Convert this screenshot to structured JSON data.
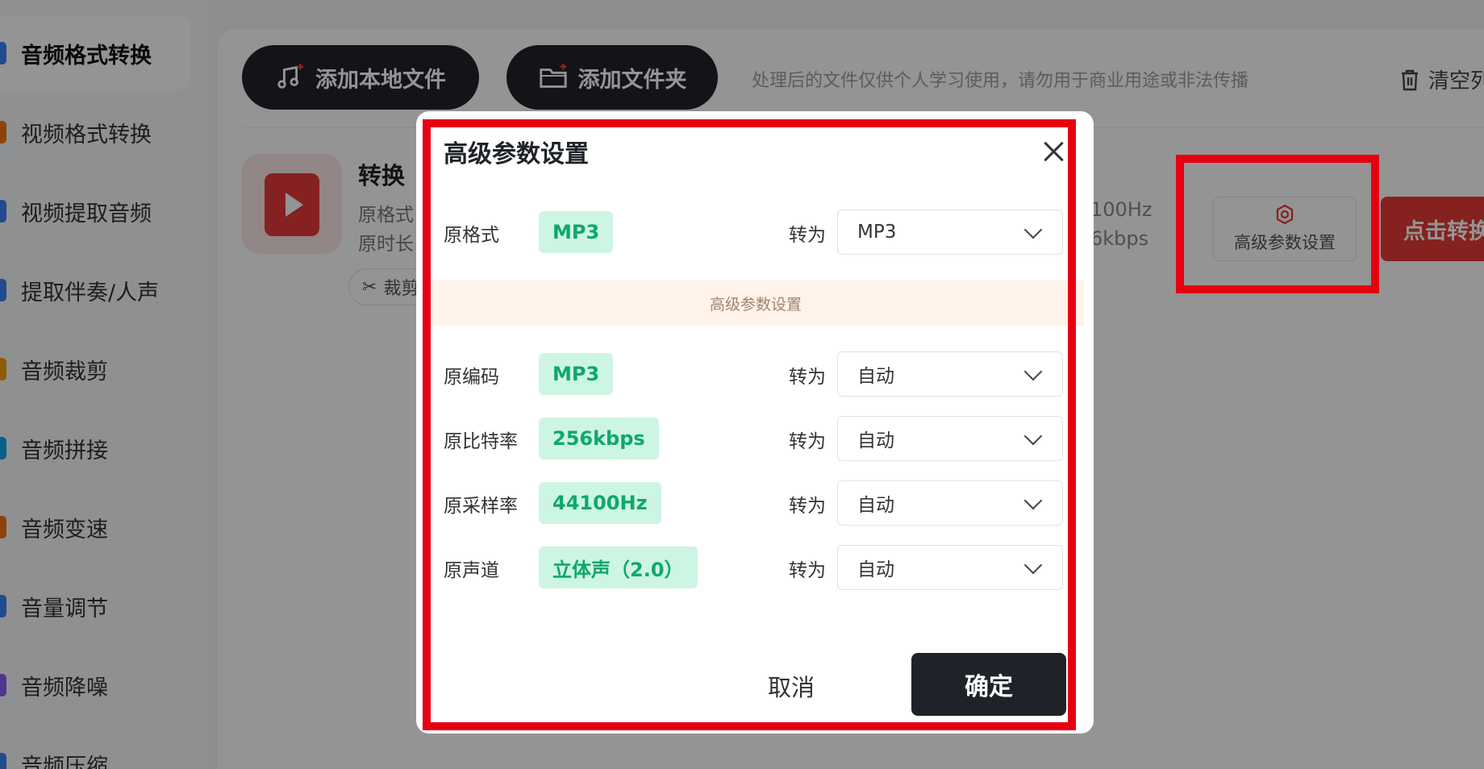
{
  "sidebar": {
    "items": [
      {
        "label": "音频格式转换",
        "color": "#3b82f6"
      },
      {
        "label": "视频格式转换",
        "color": "#f97316"
      },
      {
        "label": "视频提取音频",
        "color": "#3b82f6"
      },
      {
        "label": "提取伴奏/人声",
        "color": "#3b82f6"
      },
      {
        "label": "音频裁剪",
        "color": "#f59e0b"
      },
      {
        "label": "音频拼接",
        "color": "#0ea5e9"
      },
      {
        "label": "音频变速",
        "color": "#f97316"
      },
      {
        "label": "音量调节",
        "color": "#3b82f6"
      },
      {
        "label": "音频降噪",
        "color": "#8b5cf6"
      },
      {
        "label": "音频压缩",
        "color": "#3b82f6"
      }
    ]
  },
  "toolbar": {
    "add_file_label": "添加本地文件",
    "add_folder_label": "添加文件夹",
    "notice": "处理后的文件仅供个人学习使用，请勿用于商业用途或非法传播",
    "clear_label": "清空列"
  },
  "file": {
    "name": "转换",
    "meta_format": "原格式",
    "meta_duration": "原时长",
    "trim_label": "裁剪",
    "sample_rate": "100Hz",
    "bitrate": "6kbps"
  },
  "actions": {
    "advanced_label": "高级参数设置",
    "start_label": "点击转换"
  },
  "modal": {
    "title": "高级参数设置",
    "format_row": {
      "label": "原格式",
      "value": "MP3",
      "to": "转为",
      "selected": "MP3"
    },
    "section_label": "高级参数设置",
    "rows": [
      {
        "label": "原编码",
        "value": "MP3",
        "to": "转为",
        "selected": "自动"
      },
      {
        "label": "原比特率",
        "value": "256kbps",
        "to": "转为",
        "selected": "自动"
      },
      {
        "label": "原采样率",
        "value": "44100Hz",
        "to": "转为",
        "selected": "自动"
      },
      {
        "label": "原声道",
        "value": "立体声（2.0）",
        "to": "转为",
        "selected": "自动"
      }
    ],
    "cancel_label": "取消",
    "confirm_label": "确定"
  },
  "colors": {
    "highlight": "#e60012",
    "badge_bg": "#cdf5e4",
    "badge_text": "#0fa86a",
    "dark_button": "#1f2329",
    "start_button": "#e53935"
  }
}
